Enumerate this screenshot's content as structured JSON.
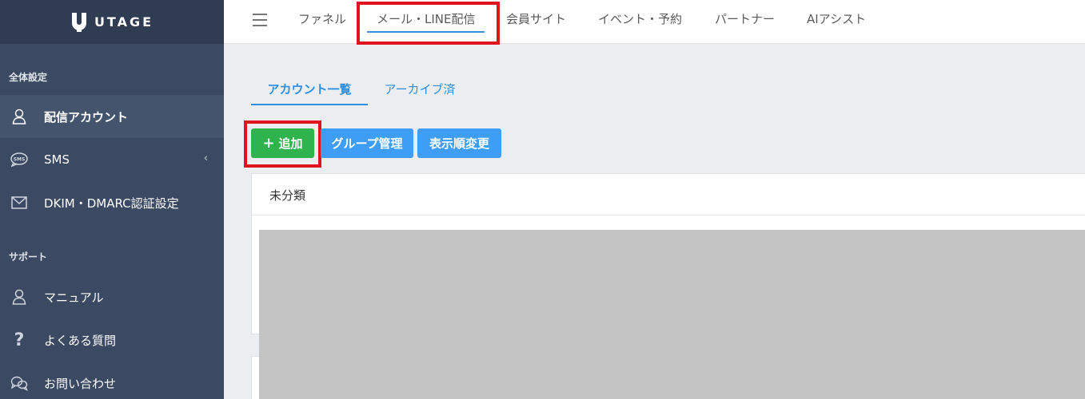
{
  "brand": {
    "name": "UTAGE"
  },
  "sidebar": {
    "sections": [
      {
        "label": "全体設定"
      },
      {
        "label": "サポート"
      }
    ],
    "items": [
      {
        "label": "配信アカウント",
        "icon": "user-icon",
        "active": true
      },
      {
        "label": "SMS",
        "icon": "sms-icon",
        "has_children": true
      },
      {
        "label": "DKIM・DMARC認証設定",
        "icon": "mail-icon"
      },
      {
        "label": "マニュアル",
        "icon": "user-icon"
      },
      {
        "label": "よくある質問",
        "icon": "question-icon"
      },
      {
        "label": "お問い合わせ",
        "icon": "chat-icon"
      }
    ],
    "chevron": "‹"
  },
  "topnav": {
    "tabs": [
      {
        "label": "ファネル"
      },
      {
        "label": "メール・LINE配信",
        "active": true
      },
      {
        "label": "会員サイト"
      },
      {
        "label": "イベント・予約"
      },
      {
        "label": "パートナー"
      },
      {
        "label": "AIアシスト"
      }
    ]
  },
  "subtabs": [
    {
      "label": "アカウント一覧",
      "active": true
    },
    {
      "label": "アーカイブ済"
    }
  ],
  "toolbar": {
    "add_label": "追加",
    "group_label": "グループ管理",
    "order_label": "表示順変更"
  },
  "card": {
    "title": "未分類"
  },
  "colors": {
    "sidebar_bg": "#3b4a62",
    "accent_blue": "#3e9ef5",
    "add_green": "#2fb34c",
    "highlight_red": "#e0141e"
  }
}
